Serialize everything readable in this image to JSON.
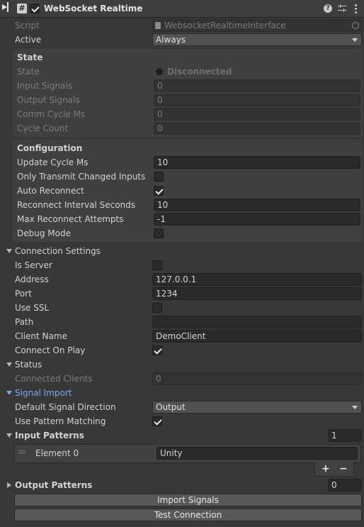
{
  "header": {
    "component_icon": "#",
    "title": "WebSocket Realtime",
    "enabled": true,
    "icons": [
      "help-icon",
      "presets-icon",
      "kebab-menu-icon"
    ]
  },
  "script_row": {
    "label": "Script",
    "value": "WebsocketRealtimeInterface"
  },
  "active_row": {
    "label": "Active",
    "value": "Always"
  },
  "state": {
    "heading": "State",
    "rows": [
      {
        "label": "State",
        "value": "Disconnected"
      },
      {
        "label": "Input Signals",
        "value": "0"
      },
      {
        "label": "Output Signals",
        "value": "0"
      },
      {
        "label": "Comm Cycle Ms",
        "value": "0"
      },
      {
        "label": "Cycle Count",
        "value": "0"
      }
    ]
  },
  "configuration": {
    "heading": "Configuration",
    "update_cycle": {
      "label": "Update Cycle Ms",
      "value": "10"
    },
    "only_transmit": {
      "label": "Only Transmit Changed Inputs",
      "checked": false
    },
    "auto_reconnect": {
      "label": "Auto Reconnect",
      "checked": true
    },
    "reconnect_interval": {
      "label": "Reconnect Interval Seconds",
      "value": "10"
    },
    "max_attempts": {
      "label": "Max Reconnect Attempts",
      "value": "-1"
    },
    "debug_mode": {
      "label": "Debug Mode",
      "checked": false
    }
  },
  "connection": {
    "heading": "Connection Settings",
    "is_server": {
      "label": "Is Server",
      "checked": false
    },
    "address": {
      "label": "Address",
      "value": "127.0.0.1"
    },
    "port": {
      "label": "Port",
      "value": "1234"
    },
    "use_ssl": {
      "label": "Use SSL",
      "checked": false
    },
    "path": {
      "label": "Path",
      "value": ""
    },
    "client_name": {
      "label": "Client Name",
      "value": "DemoClient"
    },
    "connect_on_play": {
      "label": "Connect On Play",
      "checked": true
    }
  },
  "status": {
    "heading": "Status",
    "connected_clients": {
      "label": "Connected Clients",
      "value": "0"
    }
  },
  "signal_import": {
    "heading": "Signal Import",
    "default_direction": {
      "label": "Default Signal Direction",
      "value": "Output"
    },
    "use_pattern": {
      "label": "Use Pattern Matching",
      "checked": true
    }
  },
  "input_patterns": {
    "label": "Input Patterns",
    "count": "1",
    "elements": [
      {
        "label": "Element 0",
        "value": "Unity"
      }
    ],
    "add_label": "+",
    "remove_label": "−"
  },
  "output_patterns": {
    "label": "Output Patterns",
    "count": "0"
  },
  "buttons": {
    "import": "Import Signals",
    "test": "Test Connection"
  },
  "colors": {
    "accent_link": "#7aa7e6",
    "background": "#383838"
  }
}
